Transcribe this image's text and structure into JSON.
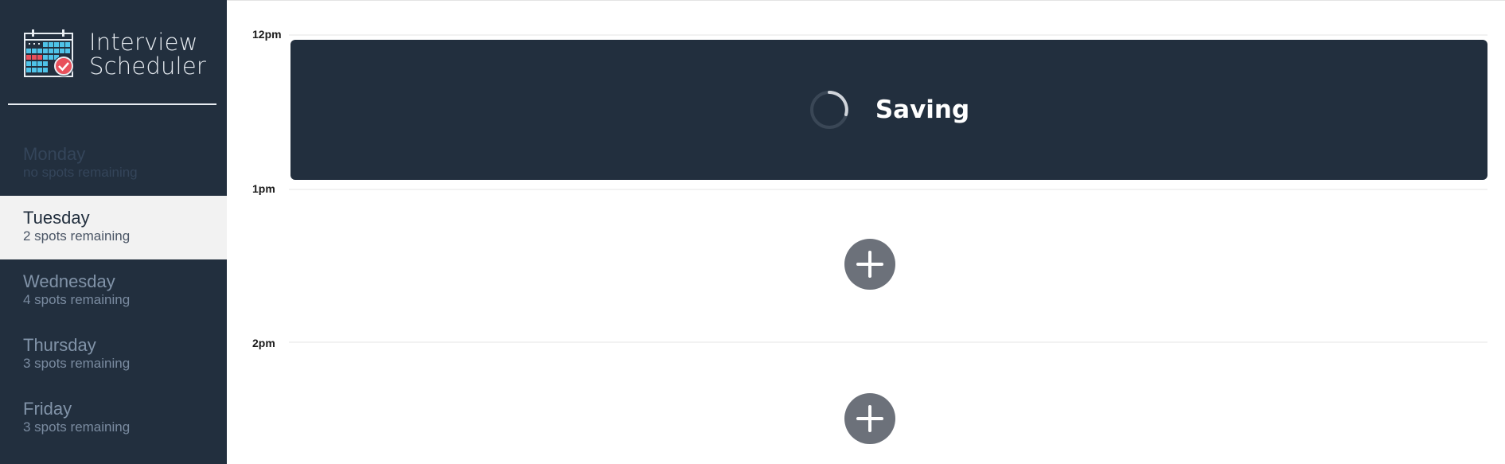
{
  "app": {
    "title_line1": "Interview",
    "title_line2": "Scheduler"
  },
  "colors": {
    "sidebar_bg": "#222f3e",
    "selected_bg": "#f2f2f2",
    "add_button": "#6c717a"
  },
  "days": [
    {
      "name": "Monday",
      "spots": "no spots remaining",
      "state": "full"
    },
    {
      "name": "Tuesday",
      "spots": "2 spots remaining",
      "state": "selected"
    },
    {
      "name": "Wednesday",
      "spots": "4 spots remaining",
      "state": "normal"
    },
    {
      "name": "Thursday",
      "spots": "3 spots remaining",
      "state": "normal"
    },
    {
      "name": "Friday",
      "spots": "3 spots remaining",
      "state": "normal"
    }
  ],
  "schedule": {
    "times": [
      "12pm",
      "1pm",
      "2pm"
    ],
    "status": {
      "text": "Saving",
      "icon": "spinner-icon"
    },
    "empty_slot_icon": "plus-icon"
  }
}
